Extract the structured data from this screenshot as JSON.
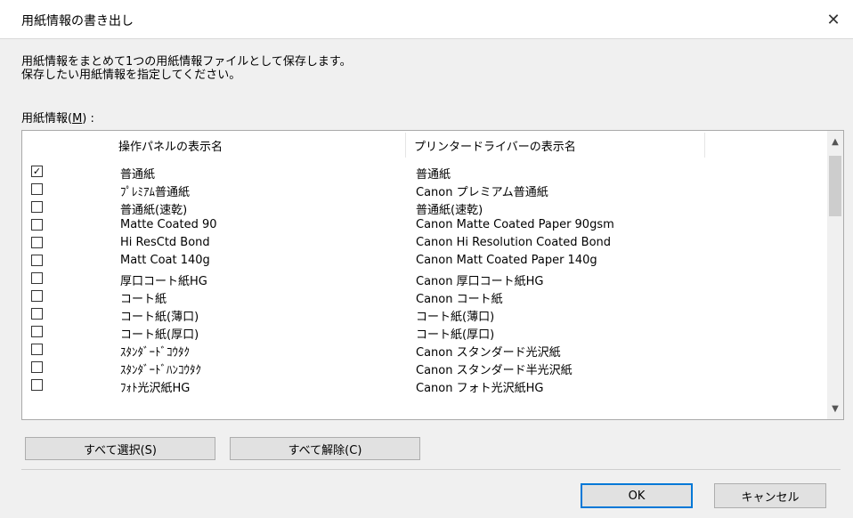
{
  "dialog": {
    "title": "用紙情報の書き出し",
    "close_glyph": "✕",
    "description_line1": "用紙情報をまとめて1つの用紙情報ファイルとして保存します。",
    "description_line2": "保存したい用紙情報を指定してください。",
    "list_label_prefix": "用紙情報(",
    "list_label_key": "M",
    "list_label_suffix": ") :"
  },
  "table": {
    "columns": [
      "操作パネルの表示名",
      "プリンタードライバーの表示名"
    ],
    "rows": [
      {
        "checked": true,
        "panel": "普通紙",
        "driver": "普通紙"
      },
      {
        "checked": false,
        "panel": "ﾌﾟﾚﾐｱﾑ普通紙",
        "driver": "Canon プレミアム普通紙"
      },
      {
        "checked": false,
        "panel": "普通紙(速乾)",
        "driver": "普通紙(速乾)"
      },
      {
        "checked": false,
        "panel": "Matte Coated 90",
        "driver": "Canon Matte Coated Paper 90gsm"
      },
      {
        "checked": false,
        "panel": "Hi ResCtd Bond",
        "driver": "Canon Hi Resolution Coated Bond"
      },
      {
        "checked": false,
        "panel": "Matt Coat 140g",
        "driver": "Canon Matt Coated Paper 140g"
      },
      {
        "checked": false,
        "panel": "厚口コート紙HG",
        "driver": "Canon 厚口コート紙HG"
      },
      {
        "checked": false,
        "panel": "コート紙",
        "driver": "Canon コート紙"
      },
      {
        "checked": false,
        "panel": "コート紙(薄口)",
        "driver": "コート紙(薄口)"
      },
      {
        "checked": false,
        "panel": "コート紙(厚口)",
        "driver": "コート紙(厚口)"
      },
      {
        "checked": false,
        "panel": "ｽﾀﾝﾀﾞｰﾄﾞｺｳﾀｸ",
        "driver": "Canon スタンダード光沢紙"
      },
      {
        "checked": false,
        "panel": "ｽﾀﾝﾀﾞｰﾄﾞﾊﾝｺｳﾀｸ",
        "driver": "Canon スタンダード半光沢紙"
      },
      {
        "checked": false,
        "panel": "ﾌｫﾄ光沢紙HG",
        "driver": "Canon フォト光沢紙HG"
      }
    ],
    "scroll_up_glyph": "▲",
    "scroll_down_glyph": "▼",
    "check_glyph": "✓"
  },
  "buttons": {
    "select_all": "すべて選択(S)",
    "deselect_all": "すべて解除(C)",
    "ok": "OK",
    "cancel": "キャンセル"
  }
}
